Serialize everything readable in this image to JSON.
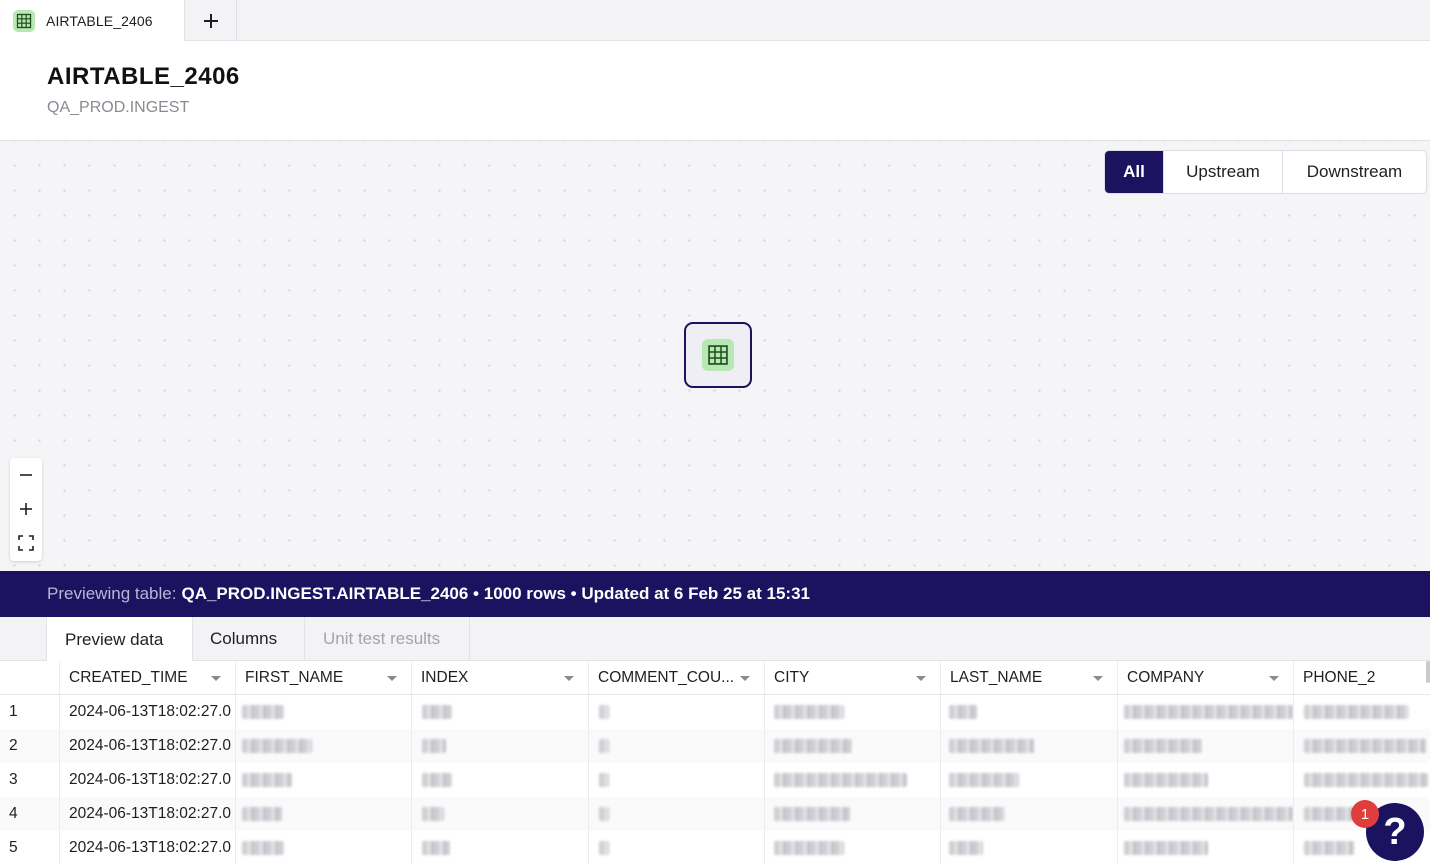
{
  "tabbar": {
    "tab_label": "AIRTABLE_2406",
    "tab_icon": "table-icon",
    "add_icon": "plus-icon"
  },
  "header": {
    "title": "AIRTABLE_2406",
    "subtitle": "QA_PROD.INGEST"
  },
  "lineage": {
    "filters": [
      "All",
      "Upstream",
      "Downstream"
    ],
    "active_filter": "All",
    "node_icon": "table-icon",
    "zoom_icons": [
      "minus-icon",
      "plus-icon",
      "fit-view-icon"
    ]
  },
  "banner": {
    "prefix": "Previewing table:",
    "value": "QA_PROD.INGEST.AIRTABLE_2406 • 1000 rows • Updated at 6 Feb 25 at 15:31"
  },
  "lower_tabs": [
    "Preview data",
    "Columns",
    "Unit test results"
  ],
  "table": {
    "columns": [
      "CREATED_TIME",
      "FIRST_NAME",
      "INDEX",
      "COMMENT_COU...",
      "CITY",
      "LAST_NAME",
      "COMPANY",
      "PHONE_2"
    ],
    "rows": [
      {
        "num": "1",
        "created_time": "2024-06-13T18:02:27.0"
      },
      {
        "num": "2",
        "created_time": "2024-06-13T18:02:27.0"
      },
      {
        "num": "3",
        "created_time": "2024-06-13T18:02:27.0"
      },
      {
        "num": "4",
        "created_time": "2024-06-13T18:02:27.0"
      },
      {
        "num": "5",
        "created_time": "2024-06-13T18:02:27.0"
      }
    ]
  },
  "help": {
    "label": "?",
    "badge_count": "1"
  },
  "colors": {
    "accent": "#1b1360",
    "table_green": "#b7e8b3",
    "badge_red": "#e03d3d"
  }
}
